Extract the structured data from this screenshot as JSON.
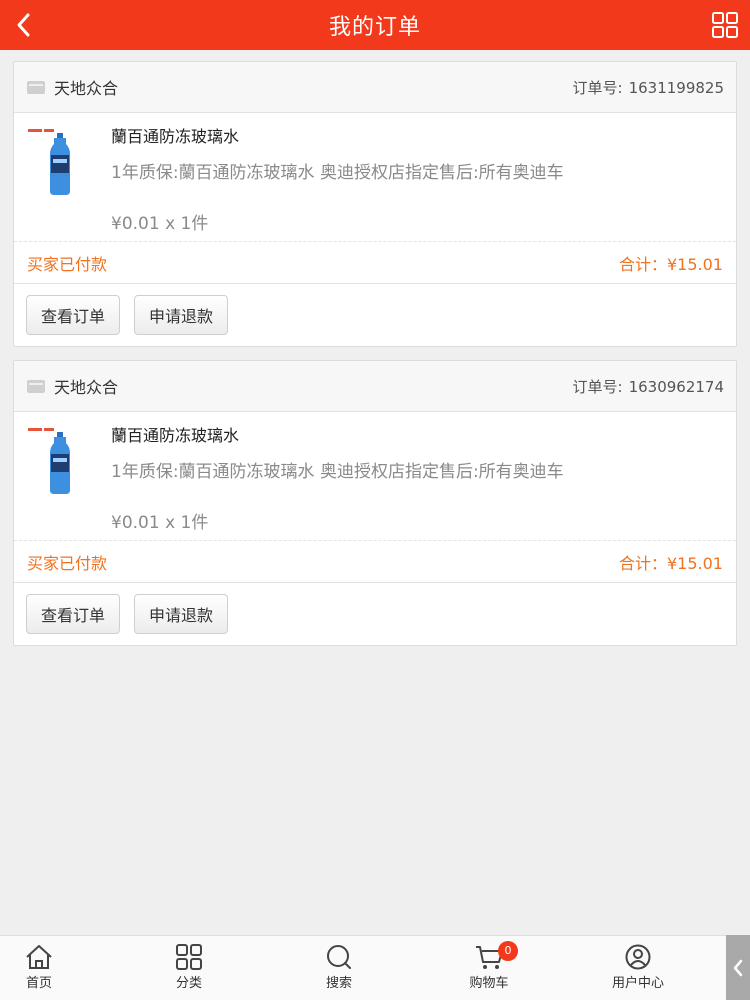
{
  "header": {
    "title": "我的订单",
    "back_icon": "chevron-left-icon",
    "menu_icon": "grid-icon"
  },
  "orders": [
    {
      "shop_name": "天地众合",
      "order_no_label": "订单号:",
      "order_no": "1631199825",
      "item": {
        "name": "蘭百通防冻玻璃水",
        "desc": "1年质保:蘭百通防冻玻璃水 奥迪授权店指定售后:所有奥迪车",
        "price": "¥0.01 x 1件"
      },
      "status": "买家已付款",
      "total": "合计：¥15.01",
      "buttons": [
        "查看订单",
        "申请退款"
      ]
    },
    {
      "shop_name": "天地众合",
      "order_no_label": "订单号:",
      "order_no": "1630962174",
      "item": {
        "name": "蘭百通防冻玻璃水",
        "desc": "1年质保:蘭百通防冻玻璃水 奥迪授权店指定售后:所有奥迪车",
        "price": "¥0.01 x 1件"
      },
      "status": "买家已付款",
      "total": "合计：¥15.01",
      "buttons": [
        "查看订单",
        "申请退款"
      ]
    }
  ],
  "tabbar": {
    "items": [
      {
        "label": "首页",
        "icon": "home-icon"
      },
      {
        "label": "分类",
        "icon": "category-icon"
      },
      {
        "label": "搜索",
        "icon": "search-icon"
      },
      {
        "label": "购物车",
        "icon": "cart-icon"
      },
      {
        "label": "用户中心",
        "icon": "user-icon"
      }
    ],
    "cart_badge": "0"
  },
  "colors": {
    "brand": "#f2391c",
    "status": "#f07320",
    "background": "#efefef"
  }
}
